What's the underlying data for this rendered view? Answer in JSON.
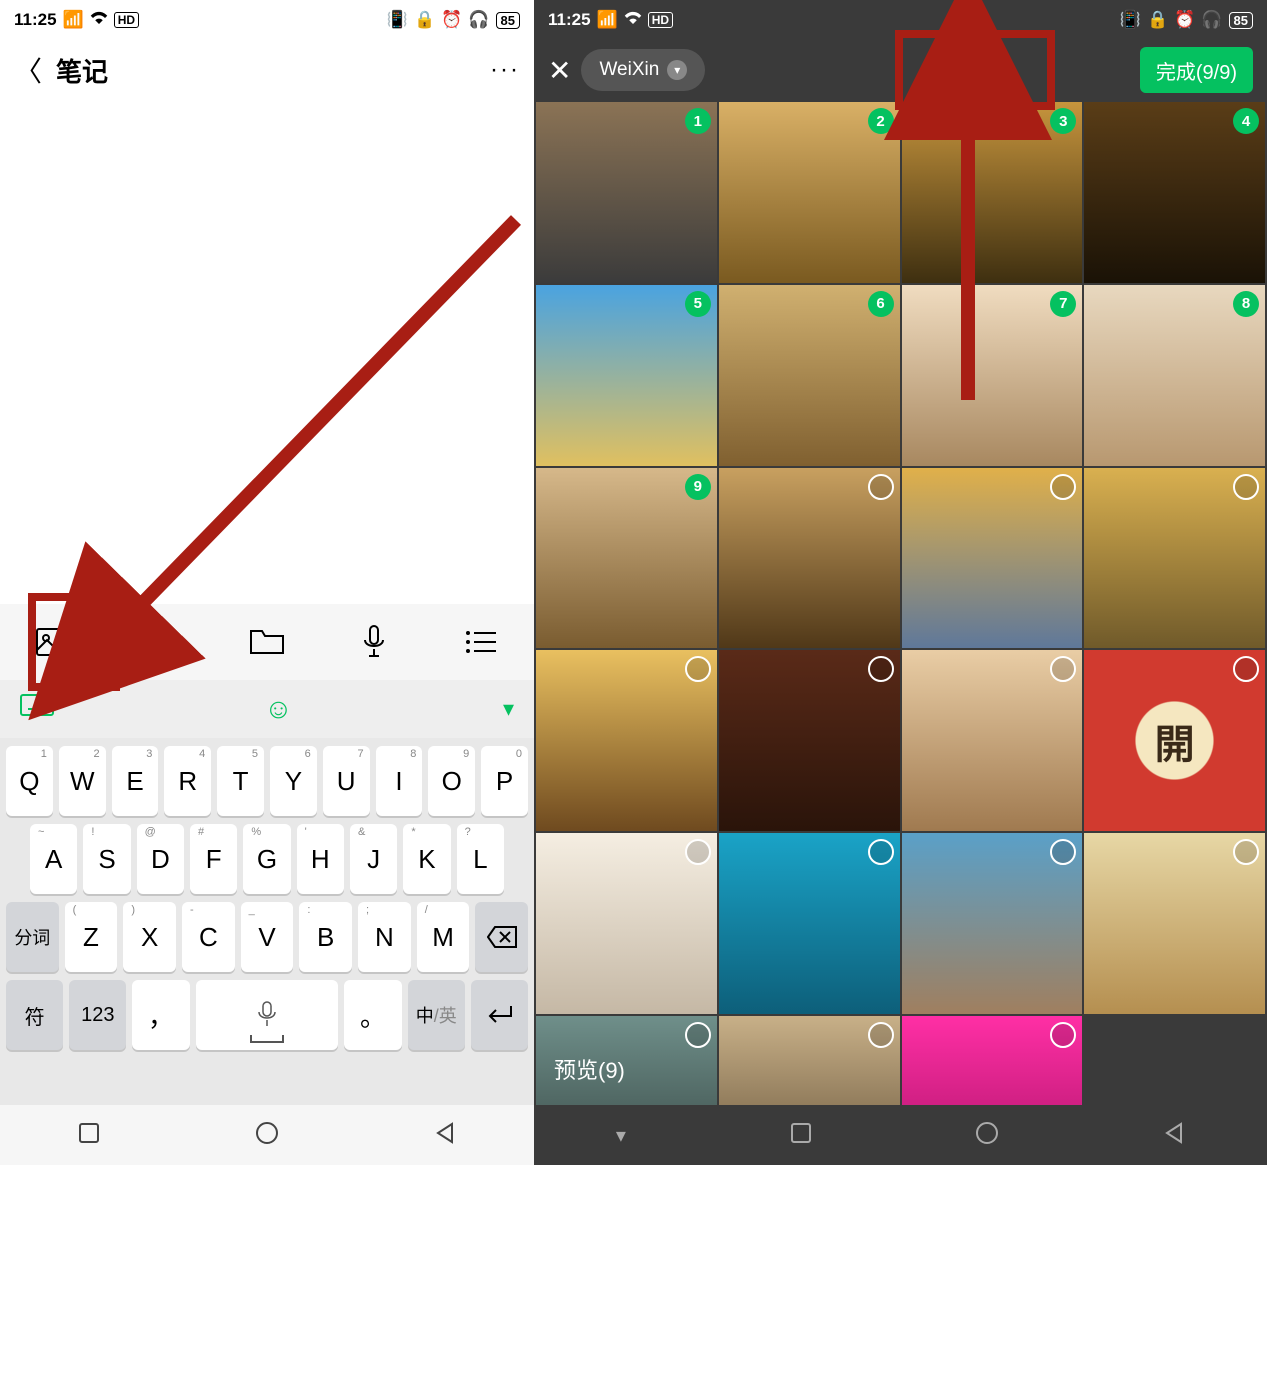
{
  "status": {
    "time": "11:25",
    "net": "4G",
    "indicators": "HD",
    "battery": "85"
  },
  "left": {
    "title": "笔记",
    "toolbar_icons": [
      "image-icon",
      "location-icon",
      "folder-icon",
      "microphone-icon",
      "list-icon"
    ],
    "ime": {
      "kb": "keyboard",
      "emoji": "smile",
      "down": "chevron-down"
    },
    "keys": {
      "row1": [
        {
          "n": "1",
          "l": "Q"
        },
        {
          "n": "2",
          "l": "W"
        },
        {
          "n": "3",
          "l": "E"
        },
        {
          "n": "4",
          "l": "R"
        },
        {
          "n": "5",
          "l": "T"
        },
        {
          "n": "6",
          "l": "Y"
        },
        {
          "n": "7",
          "l": "U"
        },
        {
          "n": "8",
          "l": "I"
        },
        {
          "n": "9",
          "l": "O"
        },
        {
          "n": "0",
          "l": "P"
        }
      ],
      "row2": [
        {
          "m": "~",
          "l": "A"
        },
        {
          "m": "!",
          "l": "S"
        },
        {
          "m": "@",
          "l": "D"
        },
        {
          "m": "#",
          "l": "F"
        },
        {
          "m": "%",
          "l": "G"
        },
        {
          "m": "'",
          "l": "H"
        },
        {
          "m": "&",
          "l": "J"
        },
        {
          "m": "*",
          "l": "K"
        },
        {
          "m": "?",
          "l": "L"
        }
      ],
      "row3_left": "分词",
      "row3": [
        {
          "m": "(",
          "l": "Z"
        },
        {
          "m": ")",
          "l": "X"
        },
        {
          "m": "-",
          "l": "C"
        },
        {
          "m": "_",
          "l": "V"
        },
        {
          "m": ":",
          "l": "B"
        },
        {
          "m": ";",
          "l": "N"
        },
        {
          "m": "/",
          "l": "M"
        }
      ],
      "row3_right": "⌫",
      "row4": {
        "sym": "符",
        "num": "123",
        "comma": "，",
        "space": "␣",
        "period": "。",
        "lang": "中/英",
        "enter": "↵"
      }
    }
  },
  "right": {
    "album": "WeiXin",
    "done": "完成(9/9)",
    "preview": "预览(9)",
    "cells": [
      {
        "sel": 1
      },
      {
        "sel": 2
      },
      {
        "sel": 3
      },
      {
        "sel": 4
      },
      {
        "sel": 5
      },
      {
        "sel": 6
      },
      {
        "sel": 7
      },
      {
        "sel": 8
      },
      {
        "sel": 9
      },
      {
        "sel": 0
      },
      {
        "sel": 0
      },
      {
        "sel": 0
      },
      {
        "sel": 0
      },
      {
        "sel": 0
      },
      {
        "sel": 0
      },
      {
        "sel": 0,
        "kai": "開"
      },
      {
        "sel": 0
      },
      {
        "sel": 0
      },
      {
        "sel": 0
      },
      {
        "sel": 0
      },
      {
        "sel": 0
      },
      {
        "sel": 0
      },
      {
        "sel": 0
      }
    ]
  }
}
